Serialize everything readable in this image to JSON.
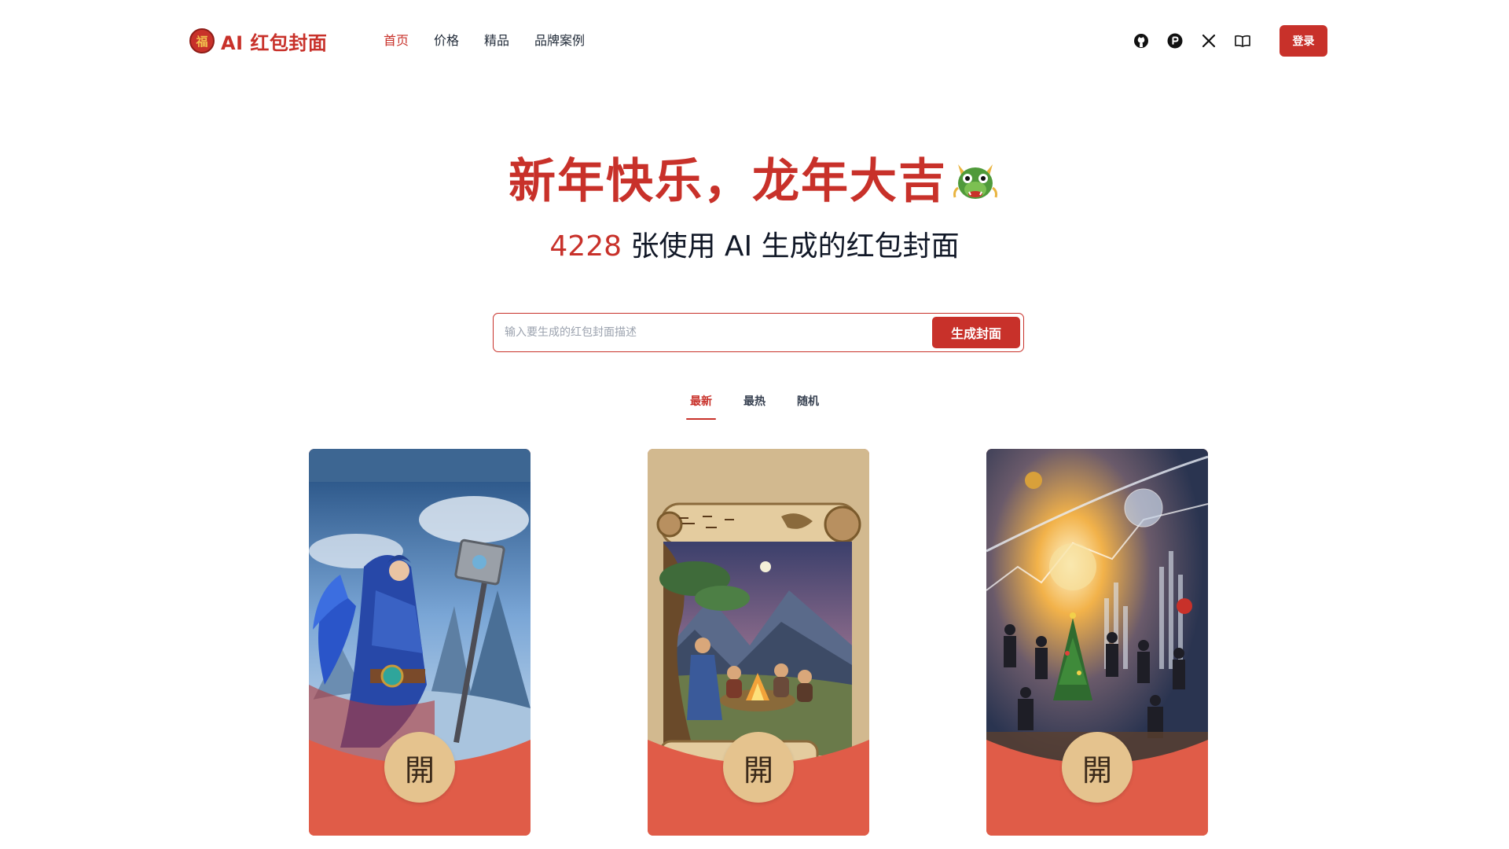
{
  "header": {
    "logo_badge": "福",
    "logo_text": "AI 红包封面",
    "nav": [
      {
        "label": "首页",
        "active": true
      },
      {
        "label": "价格",
        "active": false
      },
      {
        "label": "精品",
        "active": false
      },
      {
        "label": "品牌案例",
        "active": false
      }
    ],
    "social_icons": [
      "github-icon",
      "producthunt-icon",
      "x-icon",
      "book-icon"
    ],
    "login_label": "登录"
  },
  "hero": {
    "title": "新年快乐，龙年大吉",
    "title_emoji": "dragon-icon",
    "count": "4228",
    "subtitle": " 张使用 AI 生成的红包封面"
  },
  "search": {
    "placeholder": "输入要生成的红包封面描述",
    "value": "",
    "button_label": "生成封面"
  },
  "tabs": [
    {
      "label": "最新",
      "active": true
    },
    {
      "label": "最热",
      "active": false
    },
    {
      "label": "随机",
      "active": false
    }
  ],
  "cards": [
    {
      "open_label": "開",
      "art": "blue-robed-warrior-with-hammer"
    },
    {
      "open_label": "開",
      "art": "scroll-campfire-scene"
    },
    {
      "open_label": "開",
      "art": "business-festive-collage"
    }
  ],
  "colors": {
    "brand_red": "#c8312a",
    "card_red": "#e05c48",
    "open_gold": "#e5c38e"
  }
}
